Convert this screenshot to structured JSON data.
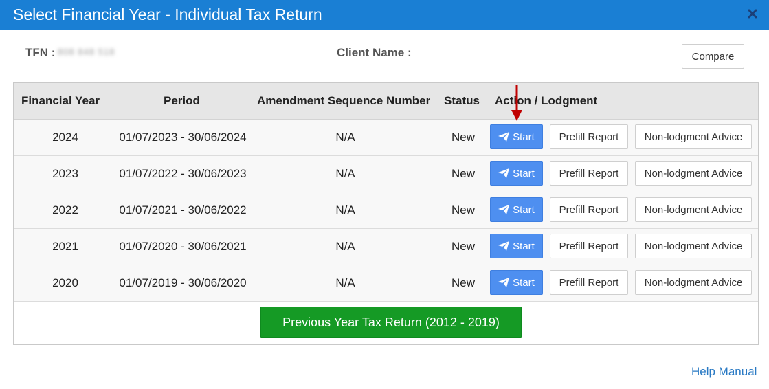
{
  "window": {
    "title": "Select Financial Year - Individual Tax Return",
    "close_icon": "close-icon"
  },
  "info": {
    "tfn_label": "TFN :",
    "tfn_value": "808 848 518",
    "client_label": "Client Name :",
    "compare_label": "Compare"
  },
  "table": {
    "headers": {
      "year": "Financial Year",
      "period": "Period",
      "amend": "Amendment Sequence Number",
      "status": "Status",
      "action": "Action / Lodgment"
    },
    "rows": [
      {
        "year": "2024",
        "period": "01/07/2023 - 30/06/2024",
        "amend": "N/A",
        "status": "New"
      },
      {
        "year": "2023",
        "period": "01/07/2022 - 30/06/2023",
        "amend": "N/A",
        "status": "New"
      },
      {
        "year": "2022",
        "period": "01/07/2021 - 30/06/2022",
        "amend": "N/A",
        "status": "New"
      },
      {
        "year": "2021",
        "period": "01/07/2020 - 30/06/2021",
        "amend": "N/A",
        "status": "New"
      },
      {
        "year": "2020",
        "period": "01/07/2019 - 30/06/2020",
        "amend": "N/A",
        "status": "New"
      }
    ],
    "actions": {
      "start": "Start",
      "start_icon": "paper-plane-icon",
      "prefill": "Prefill Report",
      "nonlodge": "Non-lodgment Advice"
    },
    "previous_button": "Previous Year Tax Return (2012 - 2019)"
  },
  "help_link": "Help Manual",
  "colors": {
    "titlebar": "#1a7fd4",
    "start_button": "#4e8ff0",
    "previous_button": "#159a25",
    "link": "#2a7ac4",
    "annotation_arrow": "#c00000"
  }
}
